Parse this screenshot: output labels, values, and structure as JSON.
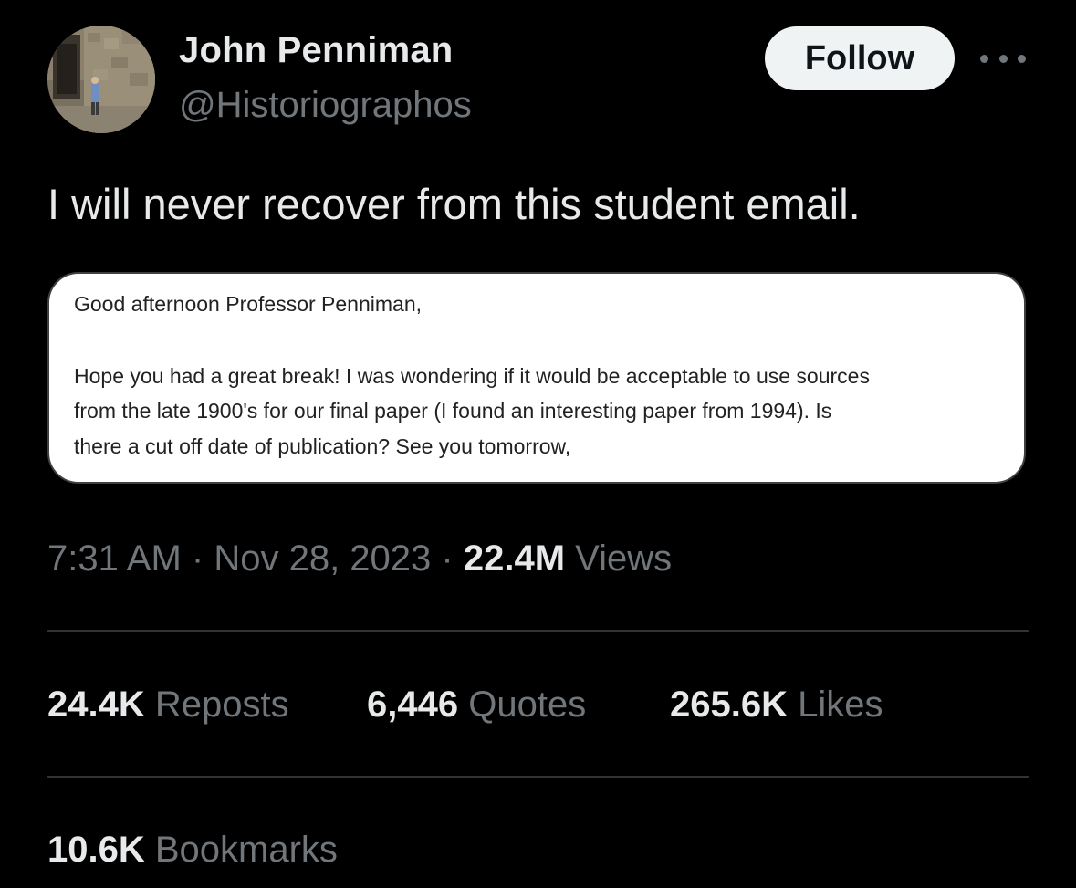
{
  "author": {
    "name": "John Penniman",
    "handle": "@Historiographos"
  },
  "follow_label": "Follow",
  "more_icon": "more-horizontal-icon",
  "tweet_text": "I will never recover from this student email.",
  "email": {
    "greeting": "Good afternoon Professor Penniman,",
    "lines": [
      "Hope you had a great break! I was wondering if it would be acceptable to use sources",
      "from the late 1900's for our final paper (I found an interesting paper from 1994). Is",
      "there a cut off date of publication? See you tomorrow,"
    ]
  },
  "meta": {
    "time": "7:31 AM",
    "separator": "·",
    "date": "Nov 28, 2023",
    "views_count": "22.4M",
    "views_label": "Views"
  },
  "stats": {
    "reposts": {
      "count": "24.4K",
      "label": "Reposts"
    },
    "quotes": {
      "count": "6,446",
      "label": "Quotes"
    },
    "likes": {
      "count": "265.6K",
      "label": "Likes"
    },
    "bookmarks": {
      "count": "10.6K",
      "label": "Bookmarks"
    }
  },
  "colors": {
    "background": "#000000",
    "primary_text": "#e7e9ea",
    "secondary_text": "#71767b",
    "divider": "#2f3336",
    "follow_bg": "#eff3f4"
  }
}
